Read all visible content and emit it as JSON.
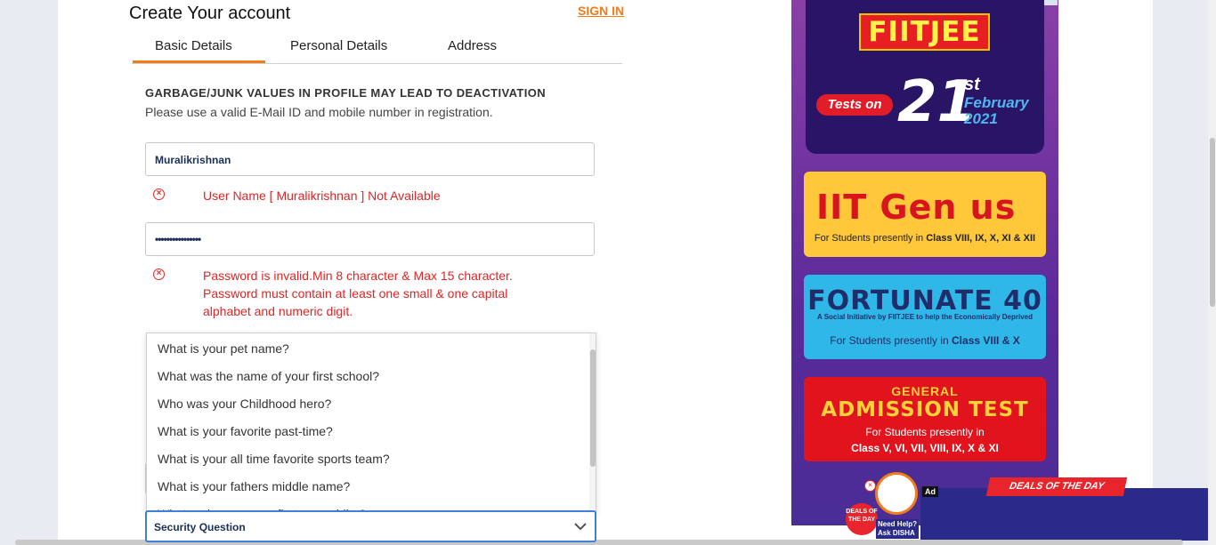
{
  "form": {
    "title": "Create Your account",
    "sign_in": "SIGN IN",
    "tabs": [
      {
        "label": "Basic Details",
        "active": true
      },
      {
        "label": "Personal Details",
        "active": false
      },
      {
        "label": "Address",
        "active": false
      }
    ],
    "warning_title": "GARBAGE/JUNK VALUES IN PROFILE MAY LEAD TO DEACTIVATION",
    "warning_sub": "Please use a valid E-Mail ID and mobile number in registration.",
    "username_value": "Muralikrishnan",
    "username_error": "User Name [ Muralikrishnan ] Not Available",
    "password_value": "••••••••••••••••",
    "password_error_lines": [
      "Password is invalid.Min 8 character & Max 15 character.",
      "Password must contain at least one small & one capital",
      "alphabet and numeric digit."
    ],
    "security_options": [
      "What is your pet name?",
      "What was the name of your first school?",
      "Who was your Childhood hero?",
      "What is your favorite past-time?",
      "What is your all time favorite sports team?",
      "What is your fathers middle name?",
      "What make was your first car or bike?"
    ],
    "security_selected": "Security Question",
    "error_icon": "error-circle-icon",
    "chevron_icon": "chevron-down-icon"
  },
  "ads": {
    "fiitjee": "FIITJEE",
    "tests_on": "Tests on",
    "date_day": "21",
    "date_suffix": "st",
    "date_month": "February",
    "date_year": "2021",
    "genius_title": "IIT Gen us",
    "genius_sub_prefix": "For Students presently in ",
    "genius_sub_classes": "Class VIII, IX, X, XI & XII",
    "fortunate_title": "FORTUNATE 40",
    "fortunate_tagline": "A Social Initiative by FIITJEE to help the Economically Deprived",
    "fortunate_sub_prefix": "For Students presently in ",
    "fortunate_sub_classes": "Class VIII & X",
    "general_title": "GENERAL",
    "admission_title": "ADMISSION TEST",
    "general_sub": "For Students presently in",
    "general_classes": "Class V, VI, VII, VIII, IX, X & XI",
    "deals_banner": "DEALS OF THE DAY",
    "ad_label": "Ad",
    "deal_circle": "DEALS OF THE DAY",
    "need_help_1": "Need Help?",
    "need_help_2": "Ask DISHA"
  }
}
